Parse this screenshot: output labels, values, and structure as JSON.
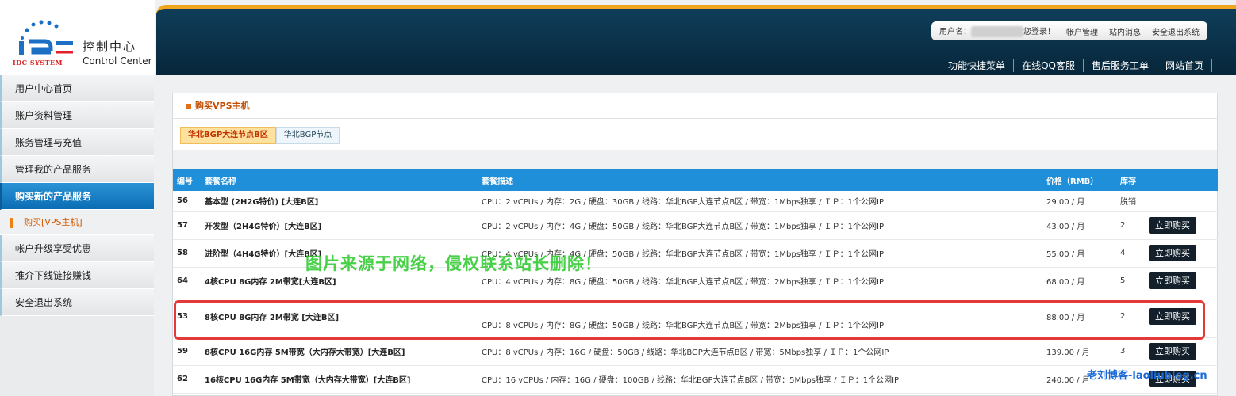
{
  "logo": {
    "title_cn": "控制中心",
    "title_en": "Control Center",
    "mark_text": "IDC SYSTEM"
  },
  "header": {
    "username_label": "用户名：",
    "welcome": "您登录！",
    "account_link": "帐户管理",
    "messages_link": "站内消息",
    "logout_link": "安全退出系统",
    "nav": [
      "功能快捷菜单",
      "在线QQ客服",
      "售后服务工单",
      "网站首页"
    ]
  },
  "sidebar": {
    "items": [
      {
        "label": "用户中心首页"
      },
      {
        "label": "账户资料管理"
      },
      {
        "label": "账务管理与充值"
      },
      {
        "label": "管理我的产品服务"
      },
      {
        "label": "购买新的产品服务"
      },
      {
        "label": "购买[VPS主机]"
      },
      {
        "label": "帐户升级享受优惠"
      },
      {
        "label": "推介下线链接赚钱"
      },
      {
        "label": "安全退出系统"
      }
    ]
  },
  "panel": {
    "title": "购买VPS主机",
    "tabs": [
      "华北BGP大连节点B区",
      "华北BGP节点"
    ]
  },
  "table": {
    "headers": [
      "编号",
      "套餐名称",
      "套餐描述",
      "价格（RMB）",
      "库存"
    ],
    "rows": [
      {
        "id": "56",
        "name": "基本型 (2H2G特价) [大连B区]",
        "desc": "CPU：2 vCPUs / 内存：2G / 硬盘：30GB / 线路：华北BGP大连节点B区 / 带宽：1Mbps独享 / ＩＰ：1个公网IP",
        "price": "29.00 / 月",
        "stock": "脱销",
        "buy": ""
      },
      {
        "id": "57",
        "name": "开发型（2H4G特价）[大连B区]",
        "desc": "CPU：2 vCPUs / 内存：4G / 硬盘：50GB / 线路：华北BGP大连节点B区 / 带宽：1Mbps独享 / ＩＰ：1个公网IP",
        "price": "43.00 / 月",
        "stock": "2",
        "buy": "立即购买"
      },
      {
        "id": "58",
        "name": "进阶型（4H4G特价）[大连B区]",
        "desc": "CPU：4 vCPUs / 内存：4G / 硬盘：50GB / 线路：华北BGP大连节点B区 / 带宽：1Mbps独享 / ＩＰ：1个公网IP",
        "price": "55.00 / 月",
        "stock": "4",
        "buy": "立即购买"
      },
      {
        "id": "64",
        "name": "4核CPU 8G内存 2M带宽[大连B区]",
        "desc": "CPU：4 vCPUs / 内存：8G / 硬盘：50GB / 线路：华北BGP大连节点B区 / 带宽：2Mbps独享 / ＩＰ：1个公网IP",
        "price": "68.00 / 月",
        "stock": "5",
        "buy": "立即购买"
      },
      {
        "id": "53",
        "name": "8核CPU 8G内存 2M带宽 [大连B区]",
        "desc": "CPU：8 vCPUs / 内存：8G / 硬盘：50GB / 线路：华北BGP大连节点B区 / 带宽：2Mbps独享 / ＩＰ：1个公网IP",
        "price": "88.00 / 月",
        "stock": "2",
        "buy": "立即购买"
      },
      {
        "id": "59",
        "name": "8核CPU 16G内存 5M带宽（大内存大带宽）[大连B区]",
        "desc": "CPU：8 vCPUs / 内存：16G / 硬盘：50GB / 线路：华北BGP大连节点B区 / 带宽：5Mbps独享 / ＩＰ：1个公网IP",
        "price": "139.00 / 月",
        "stock": "3",
        "buy": "立即购买"
      },
      {
        "id": "62",
        "name": "16核CPU 16G内存 5M带宽（大内存大带宽）[大连B区]",
        "desc": "CPU：16 vCPUs / 内存：16G / 硬盘：100GB / 线路：华北BGP大连节点B区 / 带宽：5Mbps独享 / ＩＰ：1个公网IP",
        "price": "240.00 / 月",
        "stock": "",
        "buy": "立即购买"
      }
    ]
  },
  "watermark": "图片来源于网络，侵权联系站长删除！",
  "brand_watermark": "老刘博客-laoliublog.cn",
  "colors": {
    "accent": "#1e8fd8",
    "header_bg": "#0f3e5a",
    "header_stripe": "#f0a51e",
    "highlight": "#e23a3a"
  }
}
